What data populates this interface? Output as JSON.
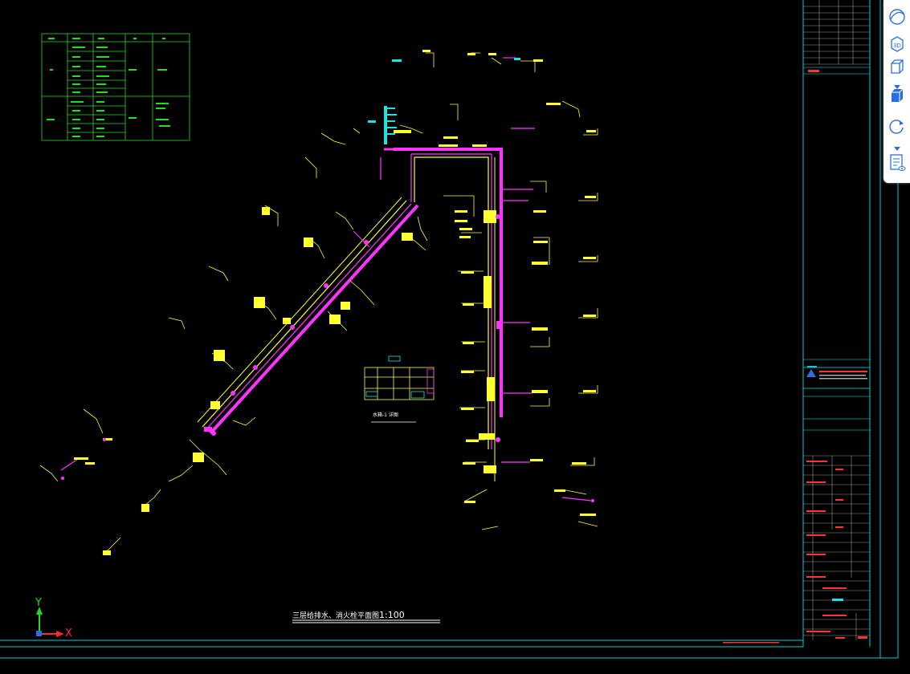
{
  "drawing": {
    "title": "三层给排水、消火栓平面图",
    "scale": "1:100",
    "section_label": "水箱-1 详图",
    "axis_x_label": "X",
    "axis_y_label": "Y"
  },
  "toolbar": {
    "buttons": [
      {
        "name": "orbit-icon",
        "label": "Orbit"
      },
      {
        "name": "3d-view-icon",
        "label": "3D"
      },
      {
        "name": "view-cube-wire-icon",
        "label": "Wireframe"
      },
      {
        "name": "view-cube-shaded-icon",
        "label": "Shaded"
      },
      {
        "name": "rotate-icon",
        "label": "Rotate"
      },
      {
        "name": "layer-list-icon",
        "label": "Layers"
      }
    ],
    "label_3d": "3D"
  },
  "colors": {
    "background": "#000000",
    "border": "#00cfd6",
    "pipe": "#ff33ff",
    "annotation": "#ffff33",
    "table": "#22dd22",
    "cyan": "#22e0e0",
    "red_text": "#ff3333"
  }
}
